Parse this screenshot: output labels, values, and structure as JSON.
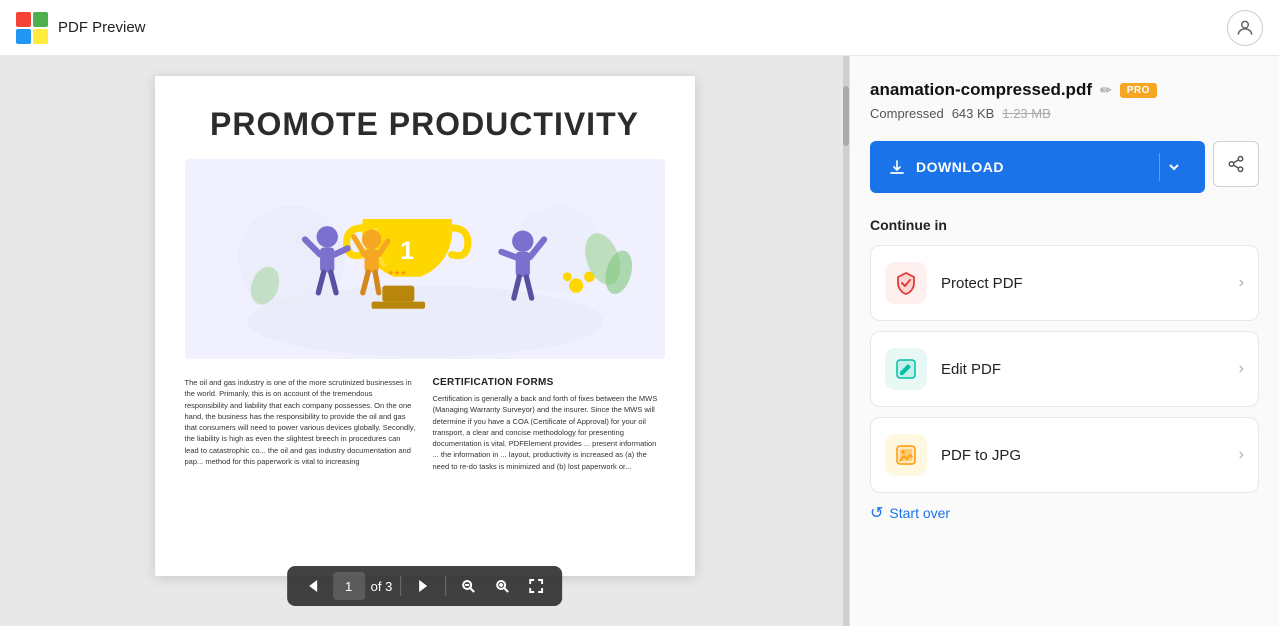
{
  "header": {
    "title": "PDF Preview",
    "logo_colors": [
      "#F44336",
      "#4CAF50",
      "#2196F3",
      "#FFEB3B"
    ]
  },
  "viewer": {
    "pdf_title": "PROMOTE PRODUCTIVITY",
    "page_current": "1",
    "page_total": "3",
    "page_of": "of 3",
    "section_title": "CERTIFICATION FORMS",
    "left_text": "The oil and gas industry is one of the more scrutinized businesses in the world. Primarily, this is on account of the tremendous responsibility and liability that each company possesses. On the one hand, the business has the responsibility to provide the oil and gas that consumers will need to power various devices globally. Secondly, the liability is high as even the slightest breech in procedures can lead to catastrophic co... the oil and gas industry documentation and pap... method for this paperwork is vital to increasing",
    "right_text": "Certification is generally a back and forth of fixes between the MWS (Managing Warranty Surveyor) and the insurer. Since the MWS will determine if you have a COA (Certificate of Approval) for your oil transport, a clear and concise methodology for presenting documentation is vital. PDFElement provides ... present information ... the information in ... layout, productivity is increased as (a) the need to re-do tasks is minimized and (b) lost paperwork or..."
  },
  "toolbar": {
    "prev_label": "‹",
    "next_label": "›",
    "fit_label": "⤢",
    "zoom_out_label": "−",
    "zoom_in_label": "+",
    "page_input_value": "1",
    "page_of": "of 3"
  },
  "sidebar": {
    "filename": "anamation-compressed.pdf",
    "edit_icon": "✏",
    "pro_badge": "PRO",
    "compressed_label": "Compressed",
    "file_size": "643 KB",
    "file_size_original": "1.23 MB",
    "download_label": "DOWNLOAD",
    "continue_title": "Continue in",
    "cards": [
      {
        "label": "Protect PDF",
        "icon_type": "protect"
      },
      {
        "label": "Edit PDF",
        "icon_type": "edit"
      },
      {
        "label": "PDF to JPG",
        "icon_type": "jpg"
      }
    ],
    "start_over_label": "Start over"
  }
}
